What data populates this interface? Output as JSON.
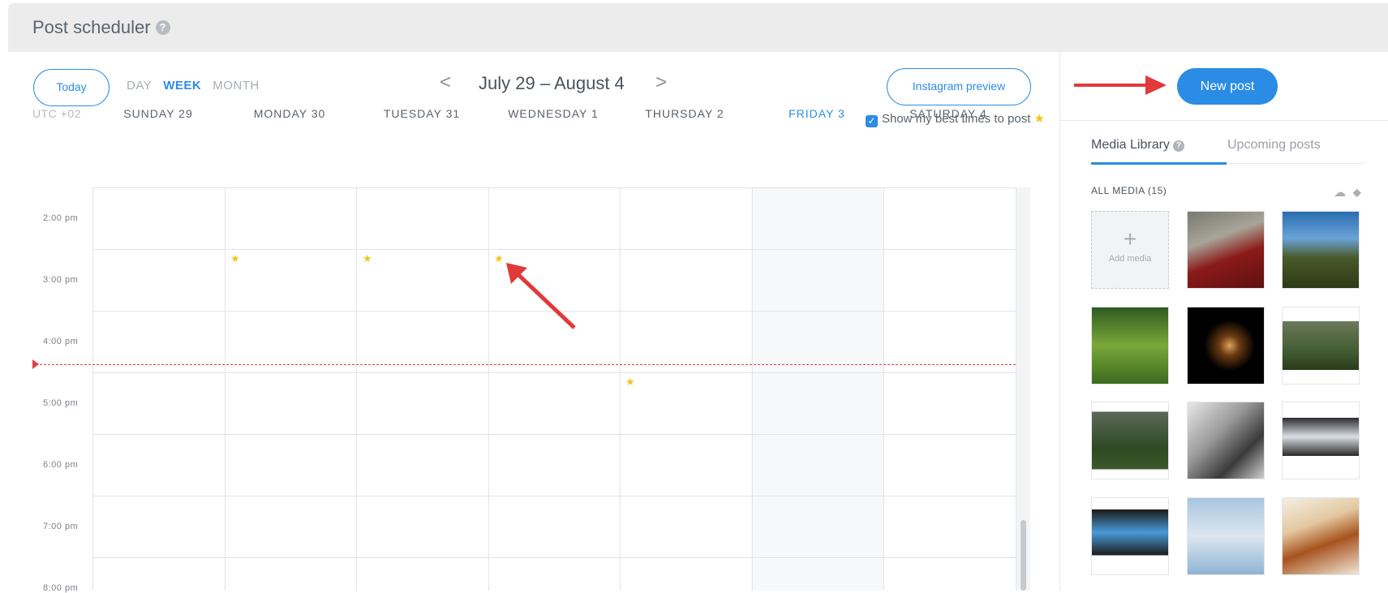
{
  "header": {
    "title": "Post scheduler",
    "help": "?"
  },
  "toolbar": {
    "today": "Today",
    "views": [
      "DAY",
      "WEEK",
      "MONTH"
    ],
    "active_view": "WEEK",
    "prev": "<",
    "next": ">",
    "range": "July 29 – August 4",
    "instagram_preview": "Instagram preview",
    "best_times": "Show my best times to post",
    "best_times_checked": true
  },
  "calendar": {
    "timezone": "UTC +02",
    "days": [
      "SUNDAY 29",
      "MONDAY 30",
      "TUESDAY 31",
      "WEDNESDAY 1",
      "THURSDAY 2",
      "FRIDAY 3",
      "SATURDAY 4"
    ],
    "current_day": "FRIDAY 3",
    "times": [
      "2:00 pm",
      "3:00 pm",
      "4:00 pm",
      "5:00 pm",
      "6:00 pm",
      "7:00 pm",
      "8:00 pm"
    ],
    "best_time_slots": [
      {
        "day": "MONDAY 30",
        "time": "3:00 pm"
      },
      {
        "day": "TUESDAY 31",
        "time": "3:00 pm"
      },
      {
        "day": "WEDNESDAY 1",
        "time": "3:00 pm"
      },
      {
        "day": "THURSDAY 2",
        "time": "5:00 pm"
      }
    ]
  },
  "sidebar": {
    "new_post": "New post",
    "tabs": [
      {
        "label": "Media Library",
        "active": true
      },
      {
        "label": "Upcoming posts",
        "active": false
      }
    ],
    "all_media": "ALL MEDIA (15)",
    "add_media": "Add media",
    "plus": "+"
  },
  "colors": {
    "accent": "#2b8ce5",
    "now_line": "#e0414a",
    "star": "#f5c518",
    "annotation_arrow": "#e03a3a"
  }
}
